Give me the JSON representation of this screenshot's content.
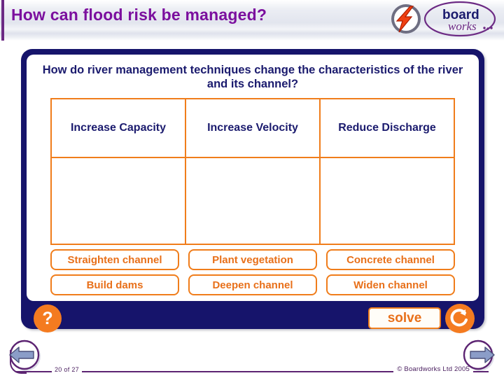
{
  "header": {
    "title": "How can flood risk be managed?",
    "logo_flash": "flash-logo-icon",
    "logo_brand_line1": "board",
    "logo_brand_line2": "works"
  },
  "activity": {
    "question": "How do river management techniques change the characteristics of the river and its channel?",
    "columns": [
      "Increase Capacity",
      "Increase Velocity",
      "Reduce Discharge"
    ],
    "drop_zones": [
      "",
      "",
      ""
    ],
    "tokens": [
      [
        "Straighten channel",
        "Plant vegetation",
        "Concrete channel"
      ],
      [
        "Build dams",
        "Deepen channel",
        "Widen channel"
      ]
    ],
    "help_label": "?",
    "solve_label": "solve",
    "reset_label": "reset-icon"
  },
  "footer": {
    "page": "20 of 27",
    "copyright": "© Boardworks Ltd 2005",
    "prev_label": "previous-slide",
    "next_label": "next-slide"
  },
  "colors": {
    "title_purple": "#7b0f9e",
    "navy": "#16146b",
    "orange": "#f07d1b",
    "footer_purple": "#5c2472"
  }
}
